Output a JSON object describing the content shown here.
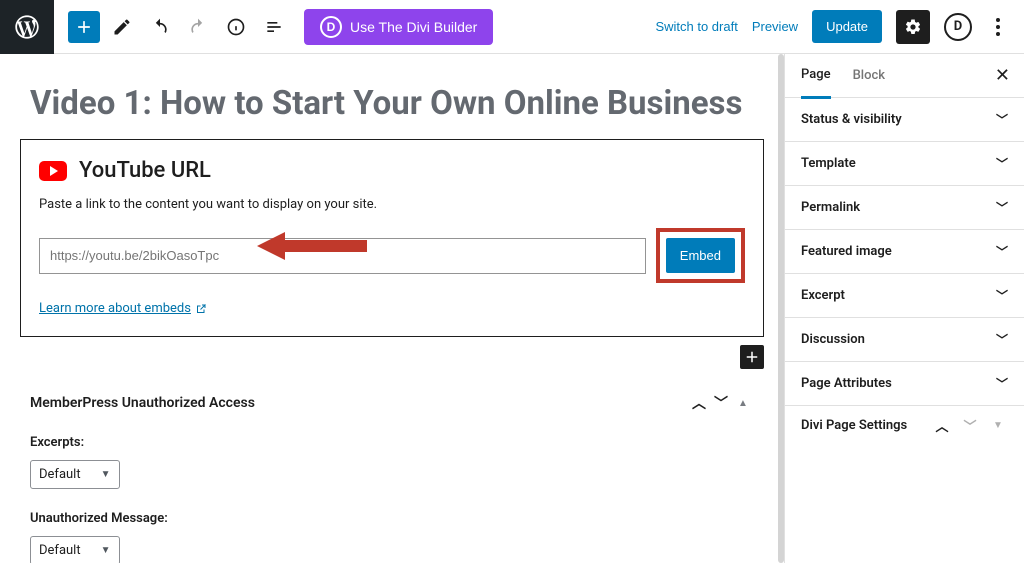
{
  "topbar": {
    "divi_button": "Use The Divi Builder",
    "switch_draft": "Switch to draft",
    "preview": "Preview",
    "update": "Update"
  },
  "page": {
    "title": "Video 1: How to Start Your Own Online Business"
  },
  "embed": {
    "title": "YouTube URL",
    "description": "Paste a link to the content you want to display on your site.",
    "placeholder": "https://youtu.be/2bikOasoTpc",
    "button": "Embed",
    "learn_more": "Learn more about embeds"
  },
  "metabox": {
    "title": "MemberPress Unauthorized Access",
    "excerpts_label": "Excerpts:",
    "excerpts_value": "Default",
    "unauth_label": "Unauthorized Message:",
    "unauth_value": "Default"
  },
  "sidebar": {
    "tabs": {
      "page": "Page",
      "block": "Block"
    },
    "panels": [
      "Status & visibility",
      "Template",
      "Permalink",
      "Featured image",
      "Excerpt",
      "Discussion",
      "Page Attributes"
    ],
    "divi_panel": "Divi Page Settings"
  }
}
